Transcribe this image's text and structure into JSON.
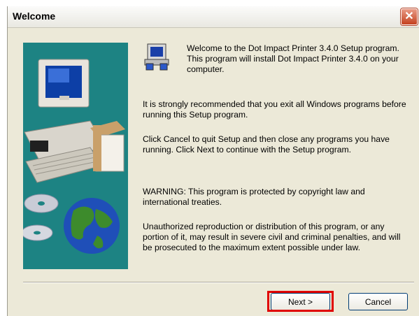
{
  "window": {
    "title": "Welcome",
    "close_glyph": "✕"
  },
  "content": {
    "intro": "Welcome to the Dot Impact Printer 3.4.0 Setup program.  This program will install Dot Impact Printer 3.4.0 on your computer.",
    "recommend": "It is strongly recommended that you exit all Windows programs before running this Setup program.",
    "instructions": "Click Cancel to quit Setup and then close any programs you have running.  Click Next to continue with the Setup program.",
    "warning": "WARNING: This program is protected by copyright law and international treaties.",
    "legal": "Unauthorized reproduction or distribution of this program, or any portion of it, may result in severe civil and criminal penalties, and will be prosecuted to the maximum extent possible under law."
  },
  "buttons": {
    "next": "Next >",
    "cancel": "Cancel"
  },
  "icons": {
    "close": "close-icon",
    "setup": "setup-computer-icon",
    "illustration": "computer-cd-globe-illustration"
  },
  "colors": {
    "side_panel": "#1d8383",
    "dialog_bg": "#ECE9D8",
    "highlight": "#e00000",
    "close_button": "#c4411f"
  }
}
